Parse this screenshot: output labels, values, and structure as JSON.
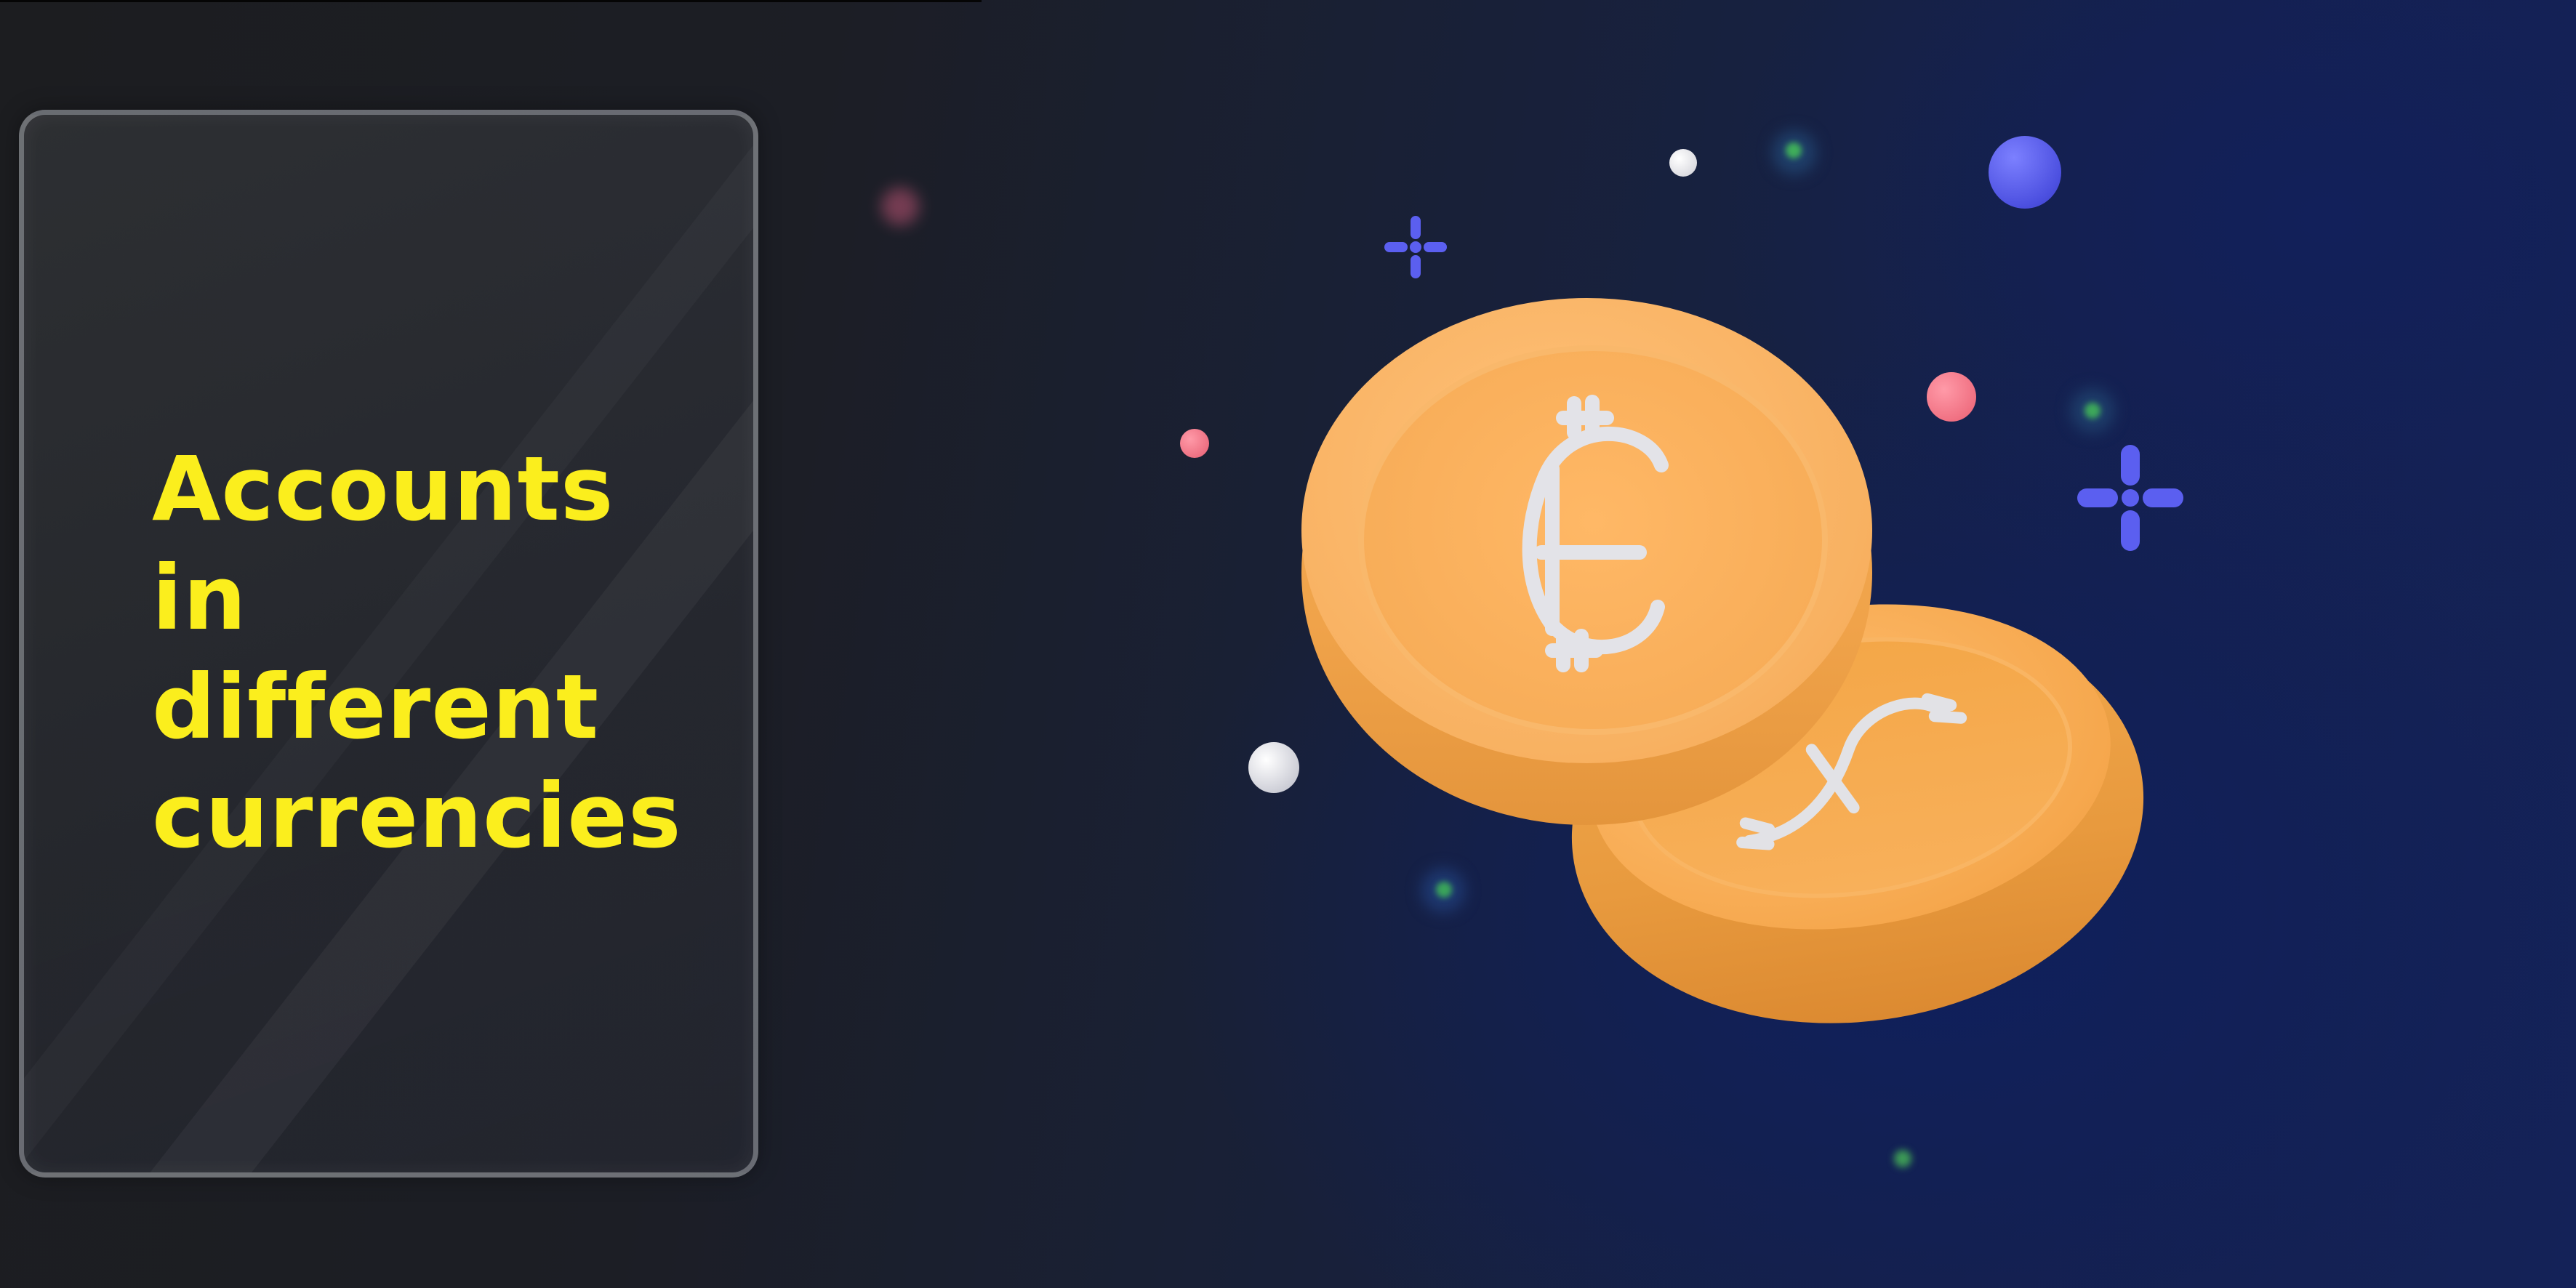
{
  "card": {
    "title_lines": [
      "Accounts in",
      "different",
      "currencies"
    ]
  },
  "colors": {
    "title": "#fbee1d",
    "coin": "#f6ac57",
    "sparkle": "#5b5ff0",
    "accent_dot_blue": "#5a5ef2",
    "accent_dot_pink": "#f07585",
    "accent_dot_white": "#e8e8ee"
  },
  "illustration": {
    "front_coin_symbol": "euro-symbol-icon",
    "back_coin_symbol": "euro-symbol-icon"
  }
}
